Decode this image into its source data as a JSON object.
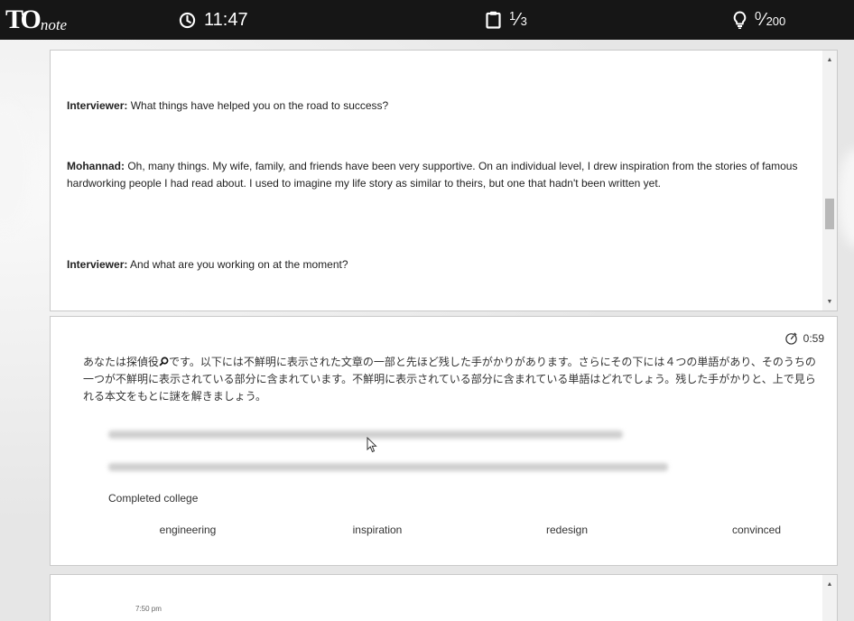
{
  "app": {
    "logo_main": "TO",
    "logo_sub": "note"
  },
  "header": {
    "clock": "11:47",
    "page_num": "1",
    "page_den": "3",
    "score_num": "0",
    "score_den": "200"
  },
  "passage": [
    {
      "speaker": "Interviewer:",
      "text": " What things have helped you on the road to success?"
    },
    {
      "speaker": "Mohannad:",
      "text": " Oh, many things. My wife, family, and friends have been very supportive. On an individual level, I drew inspiration from the stories of famous hardworking people I had read about. I used to imagine my life story as similar to theirs, but one that hadn't been written yet."
    },
    {
      "speaker": "Interviewer:",
      "text": " And what are you working on at the moment?"
    }
  ],
  "quiz": {
    "timer": "0:59",
    "instruction_a": "あなたは探偵役",
    "instruction_b": "です。以下には不鮮明に表示された文章の一部と先ほど残した手がかりがあります。さらにその下には４つの単語があり、そのうちの一つが不鮮明に表示されている部分に含まれています。不鮮明に表示されている部分に含まれている単語はどれでしょう。残した手がかりと、上で見られる本文をもとに謎を解きましょう。",
    "hint": "Completed college",
    "options": [
      "engineering",
      "inspiration",
      "redesign",
      "convinced"
    ]
  },
  "bottom": {
    "time": "7:50 pm"
  },
  "icons": {
    "clock": "clock-icon",
    "page": "clipboard-icon",
    "score": "lightbulb-icon",
    "detective": "magnifier-icon",
    "timer": "stopwatch-icon",
    "pointer": "mouse-pointer-icon"
  },
  "colors": {
    "topbar": "#161616",
    "panel": "#ffffff",
    "background": "#ececec"
  }
}
